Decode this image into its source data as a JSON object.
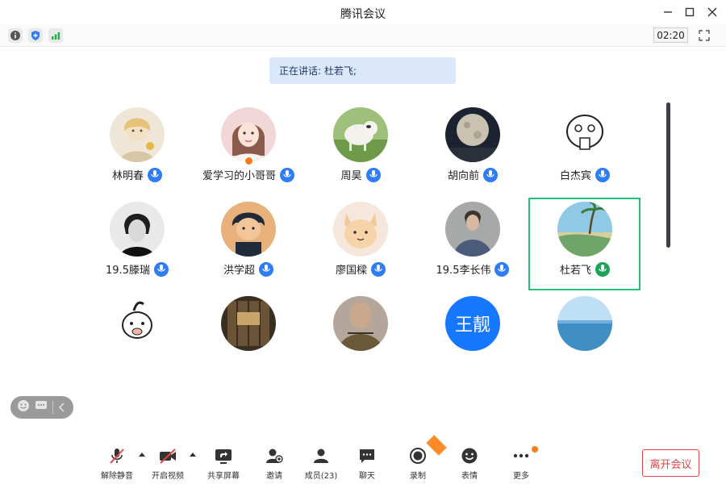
{
  "window": {
    "title": "腾讯会议",
    "controls": [
      "minimize-icon",
      "maximize-icon",
      "close-icon"
    ]
  },
  "toolbar": {
    "left_icons": [
      "info-icon",
      "shield-icon",
      "signal-icon"
    ],
    "timer": "02:20",
    "right_icon": "fullscreen-icon"
  },
  "speaking": {
    "text": "正在讲话: 杜若飞;"
  },
  "participants": [
    {
      "name": "林明春",
      "avatar": "photo",
      "mic": "on"
    },
    {
      "name": "爱学习的小哥哥",
      "avatar": "photo",
      "mic": "on",
      "host": true
    },
    {
      "name": "周昊",
      "avatar": "photo",
      "mic": "on"
    },
    {
      "name": "胡向前",
      "avatar": "photo",
      "mic": "on"
    },
    {
      "name": "白杰宾",
      "avatar": "photo",
      "mic": "on"
    },
    {
      "name": "19.5滕瑞",
      "avatar": "photo",
      "mic": "on"
    },
    {
      "name": "洪学超",
      "avatar": "photo",
      "mic": "on"
    },
    {
      "name": "廖国樑",
      "avatar": "photo",
      "mic": "on"
    },
    {
      "name": "19.5李长伟",
      "avatar": "photo",
      "mic": "on"
    },
    {
      "name": "杜若飞",
      "avatar": "photo",
      "mic": "speaking",
      "selected": true
    },
    {
      "name": "",
      "avatar": "photo"
    },
    {
      "name": "",
      "avatar": "photo"
    },
    {
      "name": "",
      "avatar": "photo"
    },
    {
      "name": "",
      "avatar": "text",
      "avatar_text": "王靓"
    },
    {
      "name": "",
      "avatar": "photo"
    }
  ],
  "bottombar": {
    "items": [
      {
        "label": "解除静音",
        "icon": "mic-muted-icon"
      },
      {
        "label": "开启视频",
        "icon": "video-off-icon"
      },
      {
        "label": "共享屏幕",
        "icon": "share-screen-icon"
      },
      {
        "label": "邀请",
        "icon": "invite-icon"
      },
      {
        "label": "成员(23)",
        "icon": "members-icon"
      },
      {
        "label": "聊天",
        "icon": "chat-icon"
      },
      {
        "label": "录制",
        "icon": "record-icon"
      },
      {
        "label": "表情",
        "icon": "emoji-icon"
      },
      {
        "label": "更多",
        "icon": "more-icon"
      }
    ],
    "leave_label": "离开会议"
  },
  "colors": {
    "accent": "#2e7cf6",
    "selected_border": "#25c07a",
    "leave": "#e04545",
    "banner": "#dbe8fb"
  }
}
